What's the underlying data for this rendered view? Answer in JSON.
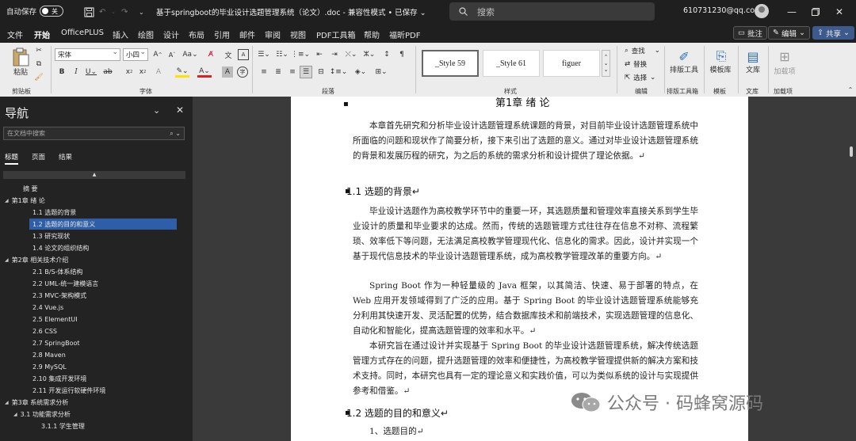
{
  "titlebar": {
    "autosave": "自动保存",
    "toggle": "关",
    "doc_title": "基于springboot的毕业设计选题管理系统（论文）.doc  -  兼容性模式 • 已保存",
    "search_placeholder": "搜索",
    "account": "610731230@qq.com"
  },
  "menu": {
    "items": [
      "文件",
      "开始",
      "OfficePLUS",
      "插入",
      "绘图",
      "设计",
      "布局",
      "引用",
      "邮件",
      "审阅",
      "视图",
      "PDF工具箱",
      "帮助",
      "福昕PDF"
    ],
    "comment": "批注",
    "edit": "编辑",
    "share": "共享"
  },
  "ribbon": {
    "paste": "粘贴",
    "font_name": "宋体",
    "font_size": "小四",
    "styles": [
      "_Style 59",
      "_Style 61",
      "figuer"
    ],
    "edit_items": [
      "查找",
      "替换",
      "选择"
    ],
    "tool_labels": [
      "排版工具",
      "模板库",
      "文库",
      "加载项"
    ],
    "groups": [
      "剪贴板",
      "字体",
      "段落",
      "样式",
      "编辑",
      "排版工具箱",
      "模板",
      "文库",
      "加载项"
    ]
  },
  "nav": {
    "title": "导航",
    "search_placeholder": "在文档中搜索",
    "tabs": [
      "标题",
      "页面",
      "结果"
    ],
    "items": [
      {
        "label": "摘  要",
        "level": 1,
        "arrow": ""
      },
      {
        "label": "第1章  绪  论",
        "level": 0,
        "arrow": "◢"
      },
      {
        "label": "1.1  选题的背景",
        "level": 2,
        "arrow": ""
      },
      {
        "label": "1.2  选题的目的和意义",
        "level": 2,
        "arrow": "",
        "selected": true
      },
      {
        "label": "1.3  研究现状",
        "level": 2,
        "arrow": ""
      },
      {
        "label": "1.4  论文的组织结构",
        "level": 2,
        "arrow": ""
      },
      {
        "label": "第2章  相关技术介绍",
        "level": 0,
        "arrow": "◢"
      },
      {
        "label": "2.1  B/S-体系结构",
        "level": 2,
        "arrow": ""
      },
      {
        "label": "2.2  UML-统一建模语言",
        "level": 2,
        "arrow": ""
      },
      {
        "label": "2.3  MVC-架构模式",
        "level": 2,
        "arrow": ""
      },
      {
        "label": "2.4  Vue.js",
        "level": 2,
        "arrow": ""
      },
      {
        "label": "2.5  ElementUI",
        "level": 2,
        "arrow": ""
      },
      {
        "label": "2.6  CSS",
        "level": 2,
        "arrow": ""
      },
      {
        "label": "2.7 SpringBoot",
        "level": 2,
        "arrow": ""
      },
      {
        "label": "2.8   Maven",
        "level": 2,
        "arrow": ""
      },
      {
        "label": "2.9  MySQL",
        "level": 2,
        "arrow": ""
      },
      {
        "label": "2.10  集成开发环境",
        "level": 2,
        "arrow": ""
      },
      {
        "label": "2.11  开发运行软硬件环境",
        "level": 2,
        "arrow": ""
      },
      {
        "label": "第3章  系统需求分析",
        "level": 0,
        "arrow": "◢"
      },
      {
        "label": "3.1  功能需求分析",
        "level": 1,
        "arrow": "◢"
      },
      {
        "label": "3.1.1  学生管理",
        "level": 3,
        "arrow": ""
      }
    ]
  },
  "doc": {
    "chapter_title": "第1章   绪   论",
    "intro": "本章首先研究和分析毕业设计选题管理系统课题的背景，对目前毕业设计选题管理系统中所面临的问题和现状作了简要分析，接下来引出了选题的意义。通过对毕业设计选题管理系统的背景和发展历程的研究，为之后的系统的需求分析和设计提供了理论依据。↵",
    "h_background": "1.1    选题的背景↵",
    "p1": "毕业设计选题作为高校教学环节中的重要一环，其选题质量和管理效率直接关系到学生毕业设计的质量和毕业要求的达成。然而，传统的选题管理方式往往存在信息不对称、流程繁琐、效率低下等问题，无法满足高校教学管理现代化、信息化的需求。因此，设计并实现一个基于现代信息技术的毕业设计选题管理系统，成为高校教学管理改革的重要方向。↵",
    "p2": "Spring Boot 作为一种轻量级的 Java 框架，以其简洁、快速、易于部署的特点，在 Web 应用开发领域得到了广泛的应用。基于 Spring Boot 的毕业设计选题管理系统能够充分利用其快速开发、灵活配置的优势，结合数据库技术和前端技术，实现选题管理的信息化、自动化和智能化，提高选题管理的效率和水平。↵",
    "p3": "本研究旨在通过设计并实现基于 Spring Boot 的毕业设计选题管理系统，解决传统选题管理方式存在的问题，提升选题管理的效率和便捷性，为高校教学管理提供新的解决方案和技术支持。同时，本研究也具有一定的理论意义和实践价值，可以为类似系统的设计与实现提供参考和借鉴。↵",
    "h_purpose": "1.2    选题的目的和意义↵",
    "p4": "1、选题目的↵"
  },
  "watermark": "公众号 · 码蜂窝源码"
}
